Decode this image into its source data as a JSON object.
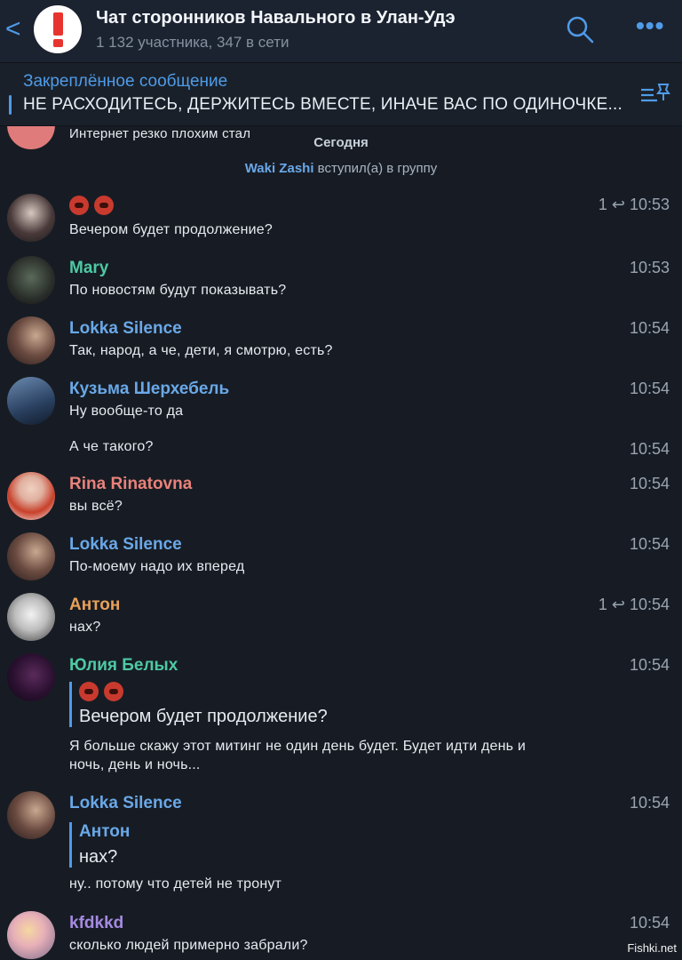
{
  "header": {
    "back": "<",
    "title": "Чат сторонников Навального в Улан-Удэ",
    "subtitle": "1 132 участника, 347 в сети",
    "more": "•••"
  },
  "pinned": {
    "title": "Закреплённое сообщение",
    "text": "НЕ РАСХОДИТЕСЬ, ДЕРЖИТЕСЬ ВМЕСТЕ, ИНАЧЕ ВАС ПО ОДИНОЧКЕ..."
  },
  "system": {
    "prev_text": "Интернет резко плохим стал",
    "today": "Сегодня",
    "join_name": "Waki Zashi",
    "join_text": " вступил(а) в группу"
  },
  "messages": [
    {
      "sender": "",
      "text": "Вечером будет продолжение?",
      "time": "10:53",
      "replies": "1"
    },
    {
      "sender": "Mary",
      "text": "По новостям будут показывать?",
      "time": "10:53"
    },
    {
      "sender": "Lokka Silence",
      "text": "Так, народ, а че, дети, я смотрю, есть?",
      "time": "10:54"
    },
    {
      "sender": "Кузьма Шерхебель",
      "text": "Ну вообще-то да",
      "time": "10:54"
    },
    {
      "sender": "",
      "text": "А че такого?",
      "time": "10:54"
    },
    {
      "sender": "Rina Rinatovna",
      "text": "вы всё?",
      "time": "10:54"
    },
    {
      "sender": "Lokka Silence",
      "text": "По-моему надо их вперед",
      "time": "10:54"
    },
    {
      "sender": "Антон",
      "text": "нах?",
      "time": "10:54",
      "replies": "1"
    },
    {
      "sender": "Юлия Белых",
      "quote_text": "Вечером будет продолжение?",
      "text_line1": "Я больше скажу этот митинг не один день будет. Будет идти день и",
      "text_line2": "ночь, день и ночь...",
      "time": "10:54"
    },
    {
      "sender": "Lokka Silence",
      "quote_title": "Антон",
      "quote_text": "нах?",
      "text": "ну.. потому что детей не тронут",
      "time": "10:54"
    },
    {
      "sender": "kfdkkd",
      "text": "сколько людей примерно забрали?",
      "time": "10:54"
    }
  ],
  "watermark": "Fishki.net",
  "colors": {
    "accent": "#4f9be8",
    "mary": "#4ec9a4",
    "lokka": "#6aa8e8",
    "kuzma": "#6aa8e8",
    "rina": "#e8827a",
    "anton": "#e8a05a",
    "yulia": "#4ec9a4",
    "kfdkkd": "#a58be0"
  }
}
